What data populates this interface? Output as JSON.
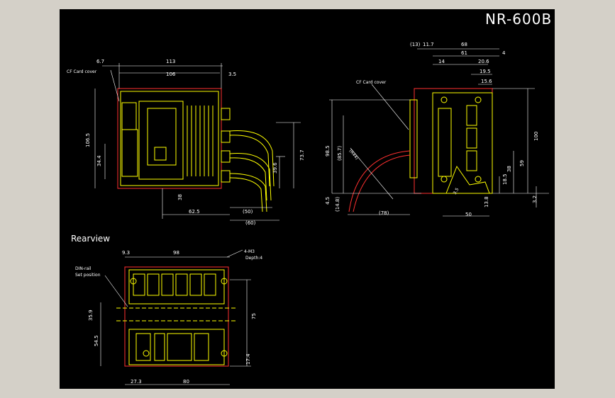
{
  "drawing": {
    "title": "NR-600B",
    "rear_label": "Rearview",
    "colors": {
      "background": "#000000",
      "outline": "#ffff00",
      "housing": "#ff3030",
      "dimension": "#ffffff",
      "frame": "#d4d0c8"
    }
  },
  "front_view": {
    "note": "CF Card cover",
    "dims": {
      "top_6_7": "6.7",
      "top_113": "113",
      "top_106": "106",
      "top_3_5": "3.5",
      "left_106_5": "106.5",
      "left_34_4": "34.4",
      "d_38": "38",
      "d_39_6": "39.6",
      "d_73_7": "73.7",
      "d_62_5": "62.5",
      "d_50": "(50)",
      "d_60": "(60)"
    }
  },
  "side_view": {
    "note": "CF Card cover",
    "radius": "(R44)",
    "dims": {
      "top_13": "(13)",
      "top_11_7": "11.7",
      "top_68": "68",
      "top_61": "61",
      "top_4": "4",
      "top_14": "14",
      "top_20_6": "20.6",
      "top_19_5": "19.5",
      "top_15_6": "15.6",
      "left_98_5": "98.5",
      "left_85_7": "(85.7)",
      "left_4_5": "4.5",
      "left_14_8": "(14.8)",
      "bottom_78": "(78)",
      "bottom_50": "50",
      "right_100": "100",
      "right_59": "59",
      "right_38": "38",
      "right_3_2": "3.2",
      "right_13_8": "13.8",
      "right_18_5": "18.5",
      "small_3_5": "3.5"
    }
  },
  "rear_view": {
    "note_din": "DIN-rail",
    "note_set": "Set position",
    "note_hole": "4-M3",
    "note_depth": "Depth:4",
    "dims": {
      "top_9_3": "9.3",
      "top_98": "98",
      "left_35_9": "35.9",
      "left_54_5": "54.5",
      "right_75": "75",
      "right_17_4": "17.4",
      "bottom_27_3": "27.3",
      "bottom_80": "80"
    }
  }
}
